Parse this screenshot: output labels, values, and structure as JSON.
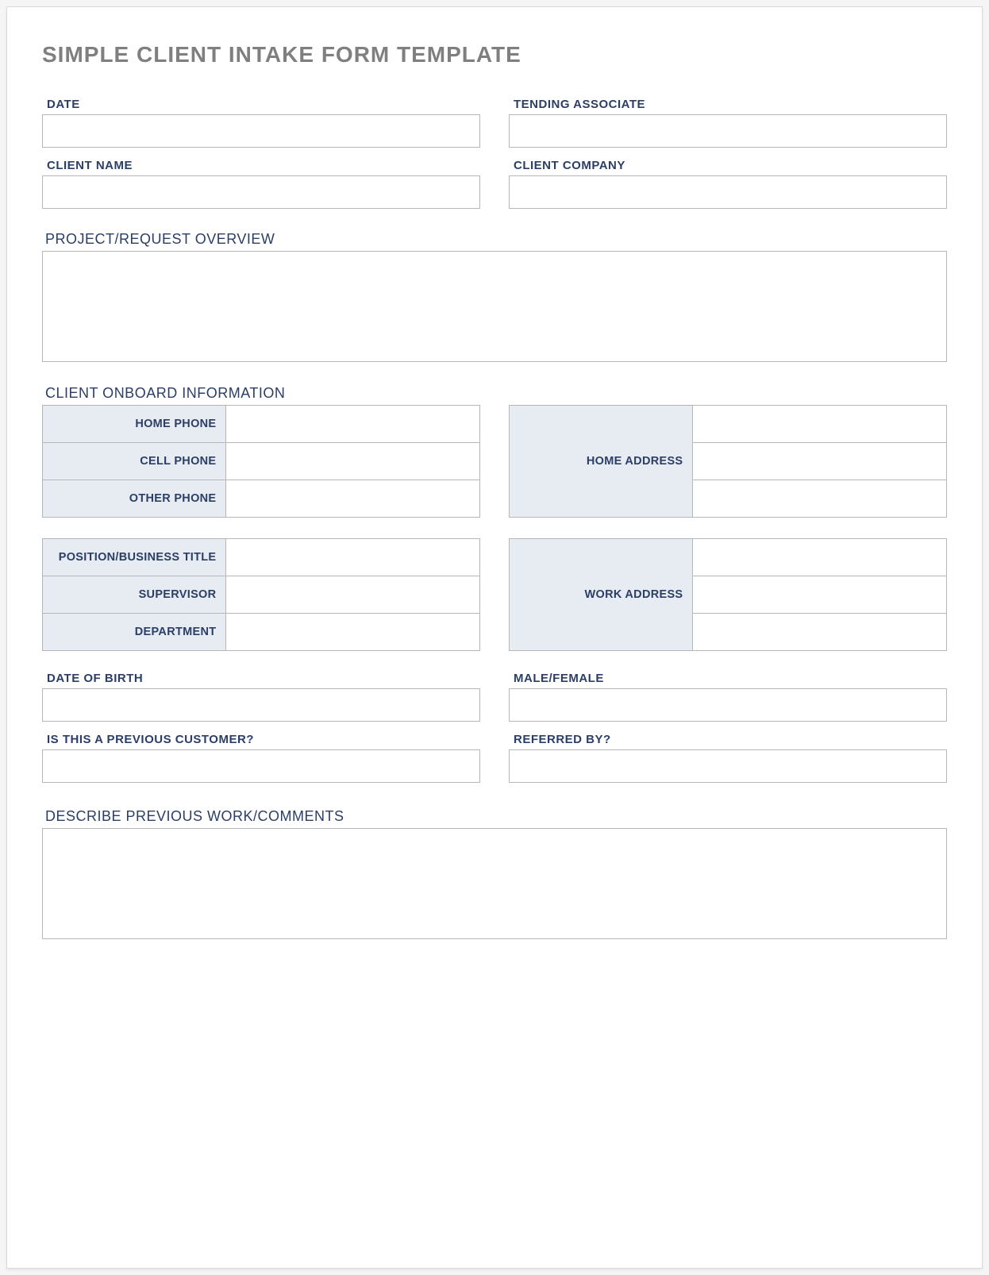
{
  "title": "SIMPLE CLIENT INTAKE FORM TEMPLATE",
  "labels": {
    "date": "DATE",
    "tending_associate": "TENDING ASSOCIATE",
    "client_name": "CLIENT NAME",
    "client_company": "CLIENT COMPANY",
    "project_overview": "PROJECT/REQUEST OVERVIEW",
    "client_onboard": "CLIENT ONBOARD INFORMATION",
    "home_phone": "HOME PHONE",
    "cell_phone": "CELL PHONE",
    "other_phone": "OTHER PHONE",
    "home_address": "HOME ADDRESS",
    "position_title": "POSITION/BUSINESS TITLE",
    "supervisor": "SUPERVISOR",
    "department": "DEPARTMENT",
    "work_address": "WORK ADDRESS",
    "dob": "DATE OF BIRTH",
    "gender": "MALE/FEMALE",
    "previous_customer": "IS THIS A PREVIOUS CUSTOMER?",
    "referred_by": "REFERRED BY?",
    "previous_work": "DESCRIBE PREVIOUS WORK/COMMENTS"
  },
  "values": {
    "date": "",
    "tending_associate": "",
    "client_name": "",
    "client_company": "",
    "project_overview": "",
    "home_phone": "",
    "cell_phone": "",
    "other_phone": "",
    "home_address_1": "",
    "home_address_2": "",
    "home_address_3": "",
    "position_title": "",
    "supervisor": "",
    "department": "",
    "work_address_1": "",
    "work_address_2": "",
    "work_address_3": "",
    "dob": "",
    "gender": "",
    "previous_customer": "",
    "referred_by": "",
    "previous_work": ""
  }
}
